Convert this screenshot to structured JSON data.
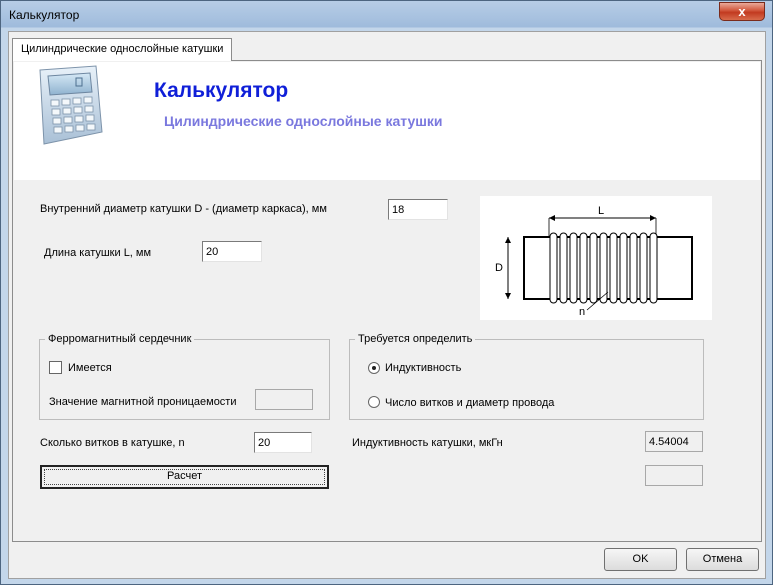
{
  "window": {
    "title": "Калькулятор",
    "close_label": "x"
  },
  "tab": {
    "label": "Цилиндрические однослойные катушки"
  },
  "header": {
    "title": "Калькулятор",
    "subtitle": "Цилиндрические однослойные катушки",
    "icon": "calculator-icon"
  },
  "inputs": {
    "diameter_label": "Внутренний диаметр катушки D - (диаметр каркаса), мм",
    "diameter_value": "18",
    "length_label": "Длина катушки L, мм",
    "length_value": "20",
    "turns_label": "Сколько витков в катушке, n",
    "turns_value": "20"
  },
  "diagram": {
    "label_L": "L",
    "label_D": "D",
    "label_n": "n"
  },
  "core_group": {
    "title": "Ферромагнитный сердечник",
    "has_core_label": "Имеется",
    "has_core_checked": false,
    "permeability_label": "Значение магнитной проницаемости",
    "permeability_value": ""
  },
  "determine_group": {
    "title": "Требуется определить",
    "options": [
      {
        "label": "Индуктивность",
        "selected": true
      },
      {
        "label": "Число витков и диаметр провода",
        "selected": false
      }
    ]
  },
  "result": {
    "inductance_label": "Индуктивность катушки, мкГн",
    "inductance_value": "4.54004",
    "extra_value": ""
  },
  "buttons": {
    "calc_label": "Расчет",
    "ok_label": "OK",
    "cancel_label": "Отмена"
  }
}
